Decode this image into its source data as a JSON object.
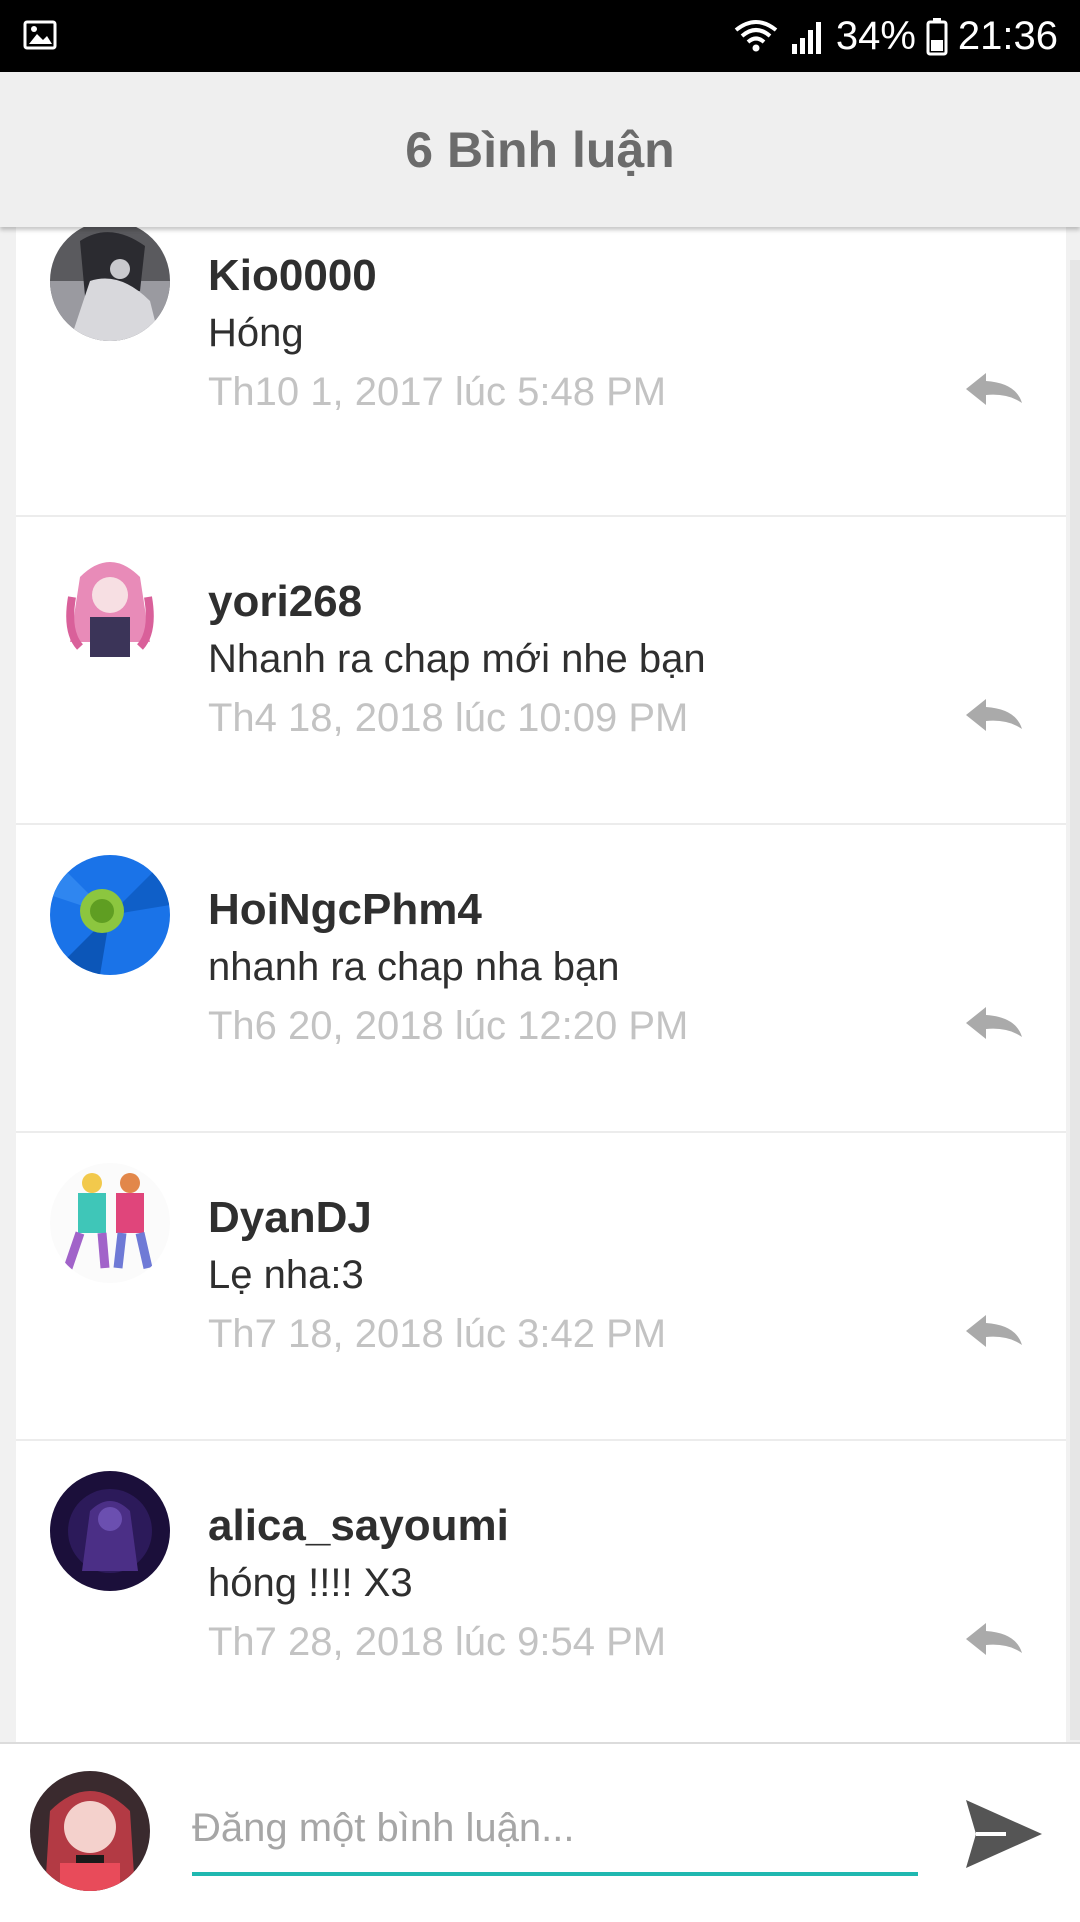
{
  "status_bar": {
    "battery": "34%",
    "time": "21:36",
    "icons": [
      "gallery-icon",
      "wifi-icon",
      "signal-icon",
      "battery-icon"
    ]
  },
  "header": {
    "title": "6 Bình luận"
  },
  "comments": [
    {
      "username": "Kio0000",
      "text": "Hóng",
      "date": "Th10 1, 2017 lúc 5:48 PM"
    },
    {
      "username": "yori268",
      "text": "Nhanh ra chap mới nhe bạn",
      "date": "Th4 18, 2018 lúc 10:09 PM"
    },
    {
      "username": "HoiNgcPhm4",
      "text": "nhanh ra chap nha bạn",
      "date": "Th6 20, 2018 lúc 12:20 PM"
    },
    {
      "username": "DyanDJ",
      "text": "Lẹ nha:3",
      "date": "Th7 18, 2018 lúc 3:42 PM"
    },
    {
      "username": "alica_sayoumi",
      "text": "hóng !!!! X3",
      "date": "Th7 28, 2018 lúc 9:54 PM"
    }
  ],
  "composer": {
    "placeholder": "Đăng một bình luận...",
    "value": ""
  },
  "colors": {
    "accent": "#1fb8b0",
    "header_bg": "#efefef",
    "header_text": "#6b6b6b",
    "date_text": "#c3c3c3",
    "reply_icon": "#aaaaaa",
    "send_icon": "#555555"
  }
}
